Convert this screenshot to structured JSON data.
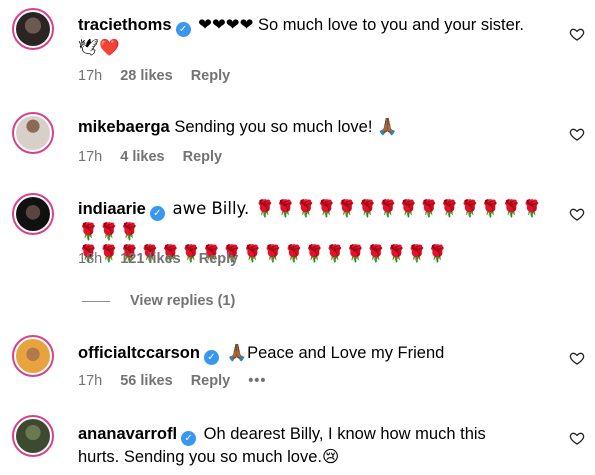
{
  "comments": [
    {
      "username": "traciethoms",
      "verified": true,
      "text": "❤❤❤❤ So much love to you and your sister.",
      "text2": "🕊❤️",
      "time": "17h",
      "likes": "28 likes",
      "reply": "Reply"
    },
    {
      "username": "mikebaerga",
      "verified": false,
      "text": "Sending you so much love! 🙏🏾",
      "time": "17h",
      "likes": "4 likes",
      "reply": "Reply"
    },
    {
      "username": "indiaarie",
      "verified": true,
      "text": "awe Billy. 🌹🌹🌹🌹🌹🌹🌹🌹🌹🌹🌹🌹🌹🌹🌹🌹🌹",
      "text2": "🌹🌹🌹🌹🌹🌹🌹🌹🌹🌹🌹🌹🌹🌹🌹🌹🌹🌹",
      "time": "18h",
      "likes": "121 likes",
      "reply": "Reply",
      "view_replies": "View replies (1)"
    },
    {
      "username": "officialtccarson",
      "verified": true,
      "text": "🙏🏾Peace and Love my Friend",
      "time": "17h",
      "likes": "56 likes",
      "reply": "Reply",
      "more": "•••"
    },
    {
      "username": "ananavarrofl",
      "verified": true,
      "text": "Oh dearest Billy, I know how much this",
      "text2": "hurts. Sending you so much love.😢",
      "time": "",
      "likes": "",
      "reply": ""
    }
  ],
  "colors": {
    "meta": "#737373",
    "verified": "#3897f0",
    "story_ring": "#d8408b"
  }
}
